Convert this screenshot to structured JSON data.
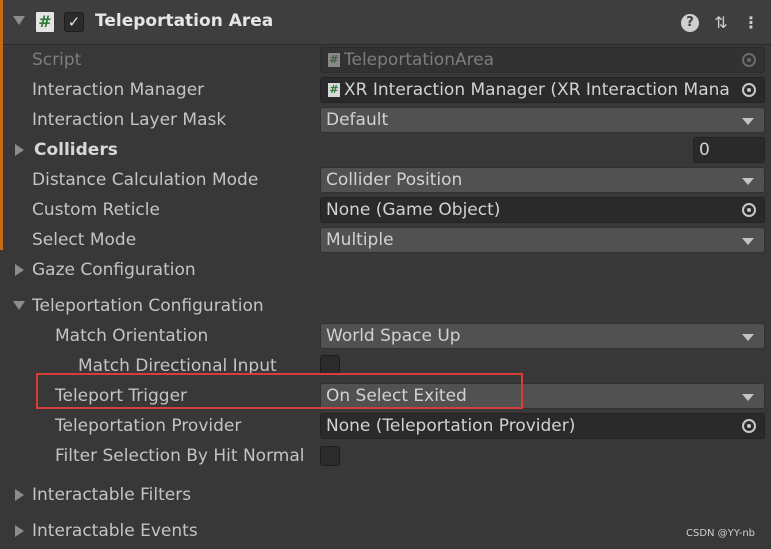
{
  "component": {
    "title": "Teleportation Area",
    "enabled_check": "✓",
    "icons": [
      "expand-arrow",
      "script-icon",
      "help-icon",
      "preset-icon",
      "menu-icon"
    ]
  },
  "fields": {
    "script": {
      "label": "Script",
      "value": "TeleportationArea",
      "icon": "#"
    },
    "interaction_manager": {
      "label": "Interaction Manager",
      "value": "XR Interaction Manager (XR Interaction Mana",
      "icon": "#"
    },
    "interaction_layer_mask": {
      "label": "Interaction Layer Mask",
      "value": "Default"
    },
    "colliders": {
      "label": "Colliders",
      "value": "0"
    },
    "distance_calculation_mode": {
      "label": "Distance Calculation Mode",
      "value": "Collider Position"
    },
    "custom_reticle": {
      "label": "Custom Reticle",
      "value": "None (Game Object)"
    },
    "select_mode": {
      "label": "Select Mode",
      "value": "Multiple"
    }
  },
  "sections": {
    "gaze": {
      "label": "Gaze Configuration"
    },
    "teleportation": {
      "label": "Teleportation Configuration"
    },
    "interactable_filters": {
      "label": "Interactable Filters"
    },
    "interactable_events": {
      "label": "Interactable Events"
    }
  },
  "teleport": {
    "match_orientation": {
      "label": "Match Orientation",
      "value": "World Space Up"
    },
    "match_directional_input": {
      "label": "Match Directional Input",
      "checked": false
    },
    "teleport_trigger": {
      "label": "Teleport Trigger",
      "value": "On Select Exited"
    },
    "teleportation_provider": {
      "label": "Teleportation Provider",
      "value": "None (Teleportation Provider)"
    },
    "filter_selection": {
      "label": "Filter Selection By Hit Normal",
      "checked": false
    }
  },
  "header_icons": {
    "help": "?",
    "preset": "⇅",
    "menu": "⋮"
  },
  "watermark": "CSDN @YY-nb",
  "colors": {
    "background": "#383838",
    "header": "#3e3e3e",
    "accent": "#c66a16",
    "highlight": "#d63e3e",
    "field": "#2a2a2a",
    "dropdown": "#515151"
  }
}
